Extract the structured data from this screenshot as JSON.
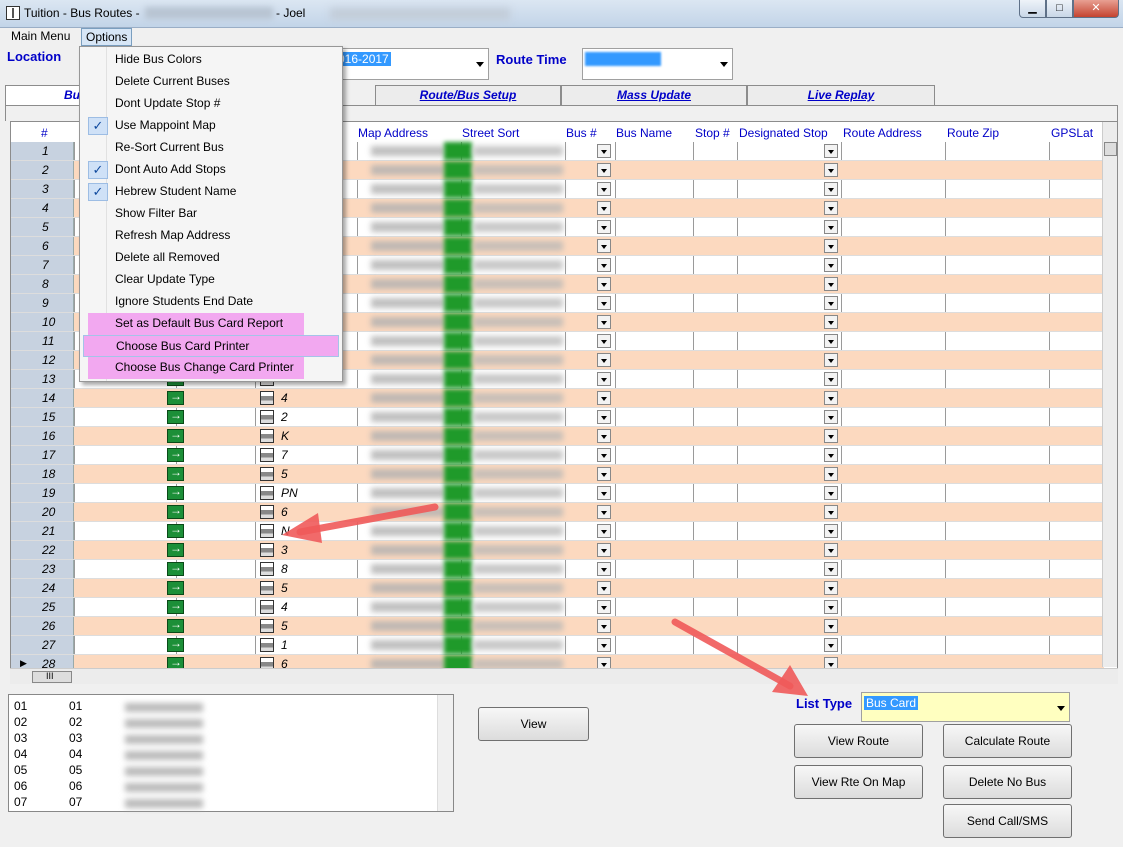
{
  "window": {
    "title": "Tuition - Bus Routes -",
    "user_suffix": "- Joel",
    "minimize": "▁",
    "maximize": "□",
    "close": "✕"
  },
  "menu": {
    "main": "Main Menu",
    "options": "Options"
  },
  "filters": {
    "location_label": "Location",
    "year_value": "016-2017",
    "route_time_label": "Route Time",
    "route_time_value": "        "
  },
  "tabs": [
    "Bu",
    "Route/Bus Setup",
    "Mass Update",
    "Live Replay"
  ],
  "grid": {
    "headers": [
      "#",
      "Map Address",
      "Street Sort",
      "Bus #",
      "Bus Name",
      "Stop #",
      "Designated Stop",
      "Route Address",
      "Route Zip",
      "GPSLat"
    ],
    "rows": [
      {
        "n": "1",
        "code": ""
      },
      {
        "n": "2",
        "code": ""
      },
      {
        "n": "3",
        "code": ""
      },
      {
        "n": "4",
        "code": ""
      },
      {
        "n": "5",
        "code": ""
      },
      {
        "n": "6",
        "code": ""
      },
      {
        "n": "7",
        "code": ""
      },
      {
        "n": "8",
        "code": ""
      },
      {
        "n": "9",
        "code": ""
      },
      {
        "n": "10",
        "code": ""
      },
      {
        "n": "11",
        "code": ""
      },
      {
        "n": "12",
        "code": ""
      },
      {
        "n": "13",
        "code": ""
      },
      {
        "n": "14",
        "code": "4"
      },
      {
        "n": "15",
        "code": "2"
      },
      {
        "n": "16",
        "code": "K"
      },
      {
        "n": "17",
        "code": "7"
      },
      {
        "n": "18",
        "code": "5"
      },
      {
        "n": "19",
        "code": "PN"
      },
      {
        "n": "20",
        "code": "6"
      },
      {
        "n": "21",
        "code": "N"
      },
      {
        "n": "22",
        "code": "3"
      },
      {
        "n": "23",
        "code": "8"
      },
      {
        "n": "24",
        "code": "5"
      },
      {
        "n": "25",
        "code": "4"
      },
      {
        "n": "26",
        "code": "5"
      },
      {
        "n": "27",
        "code": "1"
      },
      {
        "n": "28",
        "code": "6"
      }
    ],
    "row_pointer": "▶",
    "hscroll_grip": "III"
  },
  "options_menu": {
    "items": [
      {
        "label": "Hide Bus Colors",
        "checked": false
      },
      {
        "label": "Delete Current Buses",
        "checked": false
      },
      {
        "label": "Dont Update Stop #",
        "checked": false
      },
      {
        "label": "Use Mappoint Map",
        "checked": true
      },
      {
        "label": "Re-Sort Current Bus",
        "checked": false
      },
      {
        "label": "Dont Auto Add Stops",
        "checked": true
      },
      {
        "label": "Hebrew Student Name",
        "checked": true
      },
      {
        "label": "Show Filter Bar",
        "checked": false
      },
      {
        "label": "Refresh Map Address",
        "checked": false
      },
      {
        "label": "Delete all Removed",
        "checked": false
      },
      {
        "label": "Clear Update Type",
        "checked": false
      },
      {
        "label": "Ignore Students End Date",
        "checked": false
      },
      {
        "label": "Set as Default Bus Card Report",
        "checked": false
      },
      {
        "label": "Choose Bus Card Printer",
        "checked": false
      },
      {
        "label": "Choose Bus Change Card Printer",
        "checked": false
      }
    ],
    "check_glyph": "✓"
  },
  "list_panel": {
    "rows": [
      {
        "a": "01",
        "b": "01"
      },
      {
        "a": "02",
        "b": "02"
      },
      {
        "a": "03",
        "b": "03"
      },
      {
        "a": "04",
        "b": "04"
      },
      {
        "a": "05",
        "b": "05"
      },
      {
        "a": "06",
        "b": "06"
      },
      {
        "a": "07",
        "b": "07"
      }
    ]
  },
  "buttons": {
    "view": "View",
    "view_route": "View Route",
    "calculate_route": "Calculate Route",
    "view_rte_on_map": "View Rte On Map",
    "delete_no_bus": "Delete No Bus",
    "send_call_sms": "Send Call/SMS"
  },
  "list_type": {
    "label": "List Type",
    "value": "Bus Card"
  },
  "colors": {
    "accent_blue": "#0000c8",
    "row_peach": "#fcd9bf",
    "menu_highlight": "#f2a8f0",
    "annotation_arrow": "#f05a5a"
  }
}
